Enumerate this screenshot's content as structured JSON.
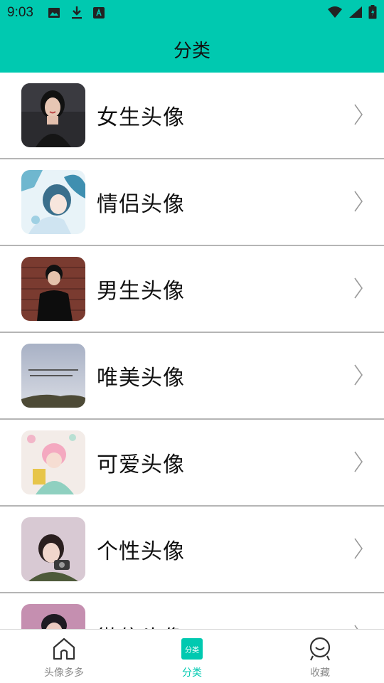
{
  "status_bar": {
    "time": "9:03"
  },
  "header": {
    "title": "分类"
  },
  "categories": [
    {
      "label": "女生头像"
    },
    {
      "label": "情侣头像"
    },
    {
      "label": "男生头像"
    },
    {
      "label": "唯美头像"
    },
    {
      "label": "可爱头像"
    },
    {
      "label": "个性头像"
    },
    {
      "label": "微信头像"
    }
  ],
  "bottom_nav": {
    "items": [
      {
        "label": "头像多多",
        "icon": "home-icon"
      },
      {
        "label": "分类",
        "icon": "category-icon",
        "badge": "分类"
      },
      {
        "label": "收藏",
        "icon": "favorites-icon"
      }
    ],
    "active_index": 1
  },
  "colors": {
    "accent": "#00c9b0",
    "divider": "#b5b5b5"
  }
}
